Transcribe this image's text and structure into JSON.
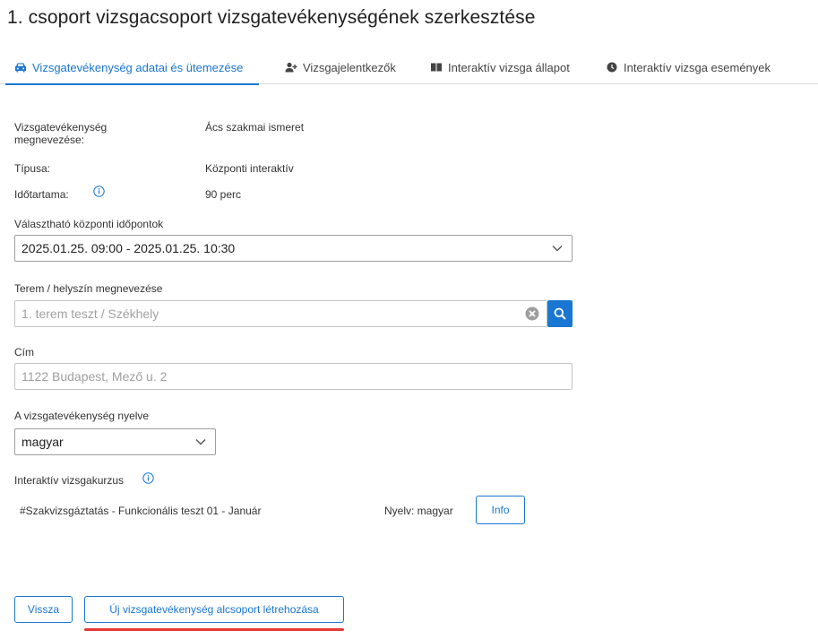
{
  "page": {
    "title": "1. csoport vizsgacsoport vizsgatevékenységének szerkesztése"
  },
  "tabs": [
    {
      "label": "Vizsgatevékenység adatai és ütemezése",
      "icon": "car-icon",
      "active": true
    },
    {
      "label": "Vizsgajelentkezők",
      "icon": "add-person-icon",
      "active": false
    },
    {
      "label": "Interaktív vizsga állapot",
      "icon": "book-icon",
      "active": false
    },
    {
      "label": "Interaktív vizsga események",
      "icon": "clock-icon",
      "active": false
    }
  ],
  "details": {
    "name_label": "Vizsgatevékenység megnevezése:",
    "name_value": "Ács szakmai ismeret",
    "type_label": "Típusa:",
    "type_value": "Központi interaktív",
    "duration_label": "Időtartama:",
    "duration_value": "90 perc"
  },
  "schedule": {
    "label": "Választható központi időpontok",
    "selected": "2025.01.25. 09:00 - 2025.01.25. 10:30"
  },
  "room": {
    "label": "Terem / helyszín megnevezése",
    "placeholder": "1. terem teszt / Székhely"
  },
  "address": {
    "label": "Cím",
    "placeholder": "1122 Budapest, Mező u. 2"
  },
  "language": {
    "label": "A vizsgatevékenység nyelve",
    "selected": "magyar"
  },
  "course": {
    "label": "Interaktív vizsgakurzus",
    "name": "#Szakvizsgáztatás - Funkcionális teszt 01 - Január",
    "language_text": "Nyelv: magyar",
    "info_button": "Info"
  },
  "actions": {
    "back_button": "Vissza",
    "create_subgroup_button": "Új vizsgatevékenység alcsoport létrehozása"
  },
  "colors": {
    "accent": "#1976d2",
    "highlight_underline": "#e53935"
  }
}
